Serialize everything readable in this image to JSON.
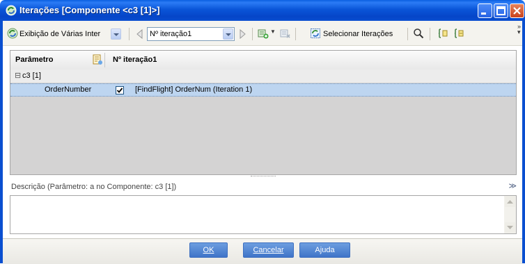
{
  "window": {
    "title": "Iterações [Componente <c3 [1]>]"
  },
  "toolbar": {
    "view_mode": "Exibição de Várias Inter",
    "iteration_select": "Nº iteração1",
    "select_iterations_label": "Selecionar Iterações"
  },
  "grid": {
    "columns": [
      "Parâmetro",
      "Nº iteração1"
    ],
    "group": {
      "toggle": "⊟",
      "label": "c3 [1]"
    },
    "rows": [
      {
        "parameter": "OrderNumber",
        "checked": true,
        "value": "[FindFlight] OrderNum (Iteration 1)"
      }
    ]
  },
  "description": {
    "label": "Descrição (Parâmetro: a no Componente: c3 [1])",
    "text": ""
  },
  "buttons": {
    "ok": "OK",
    "cancel": "Cancelar",
    "help": "Ajuda"
  },
  "colors": {
    "titlebar": "#0a55d8",
    "selected_row": "#bdd5f0",
    "button": "#3f74c8"
  }
}
